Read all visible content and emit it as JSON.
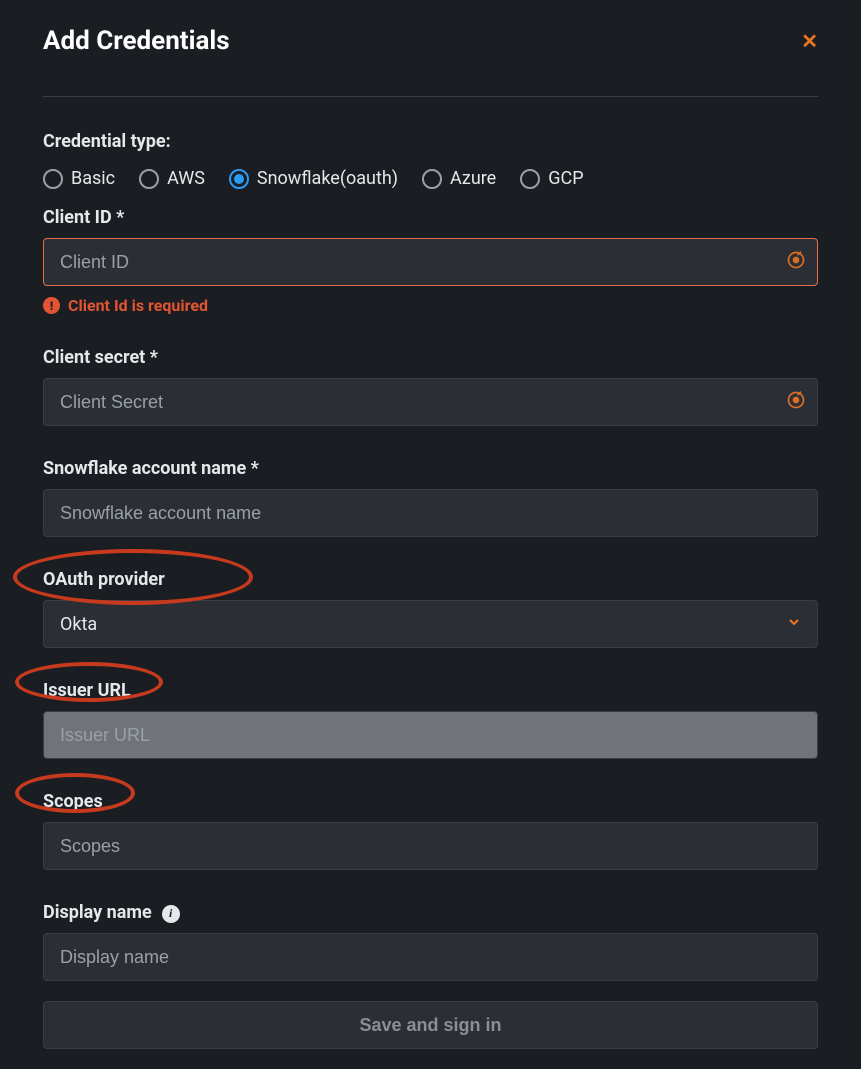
{
  "header": {
    "title": "Add Credentials"
  },
  "section": {
    "credential_type_label": "Credential type:"
  },
  "radios": {
    "basic": "Basic",
    "aws": "AWS",
    "snowflake": "Snowflake(oauth)",
    "azure": "Azure",
    "gcp": "GCP"
  },
  "fields": {
    "client_id": {
      "label": "Client ID *",
      "placeholder": "Client ID",
      "error": "Client Id is required"
    },
    "client_secret": {
      "label": "Client secret *",
      "placeholder": "Client Secret"
    },
    "account_name": {
      "label": "Snowflake account name *",
      "placeholder": "Snowflake account name"
    },
    "oauth_provider": {
      "label": "OAuth provider",
      "value": "Okta"
    },
    "issuer_url": {
      "label": "Issuer URL",
      "placeholder": "Issuer URL"
    },
    "scopes": {
      "label": "Scopes",
      "placeholder": "Scopes"
    },
    "display_name": {
      "label": "Display name",
      "placeholder": "Display name"
    }
  },
  "buttons": {
    "submit": "Save and sign in"
  }
}
